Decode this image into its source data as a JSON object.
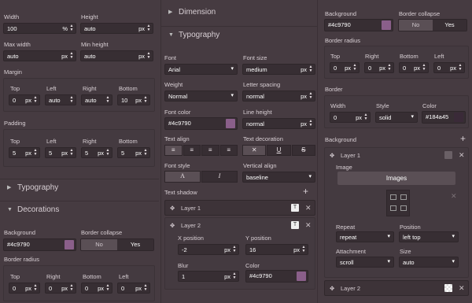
{
  "col1": {
    "width_label": "Width",
    "width_value": "100",
    "width_unit": "%",
    "height_label": "Height",
    "height_value": "auto",
    "height_unit": "px",
    "minwidth_label": "Max width",
    "minwidth_value": "auto",
    "minwidth_unit": "px",
    "minheight_label": "Min height",
    "minheight_value": "auto",
    "minheight_unit": "px",
    "margin_label": "Margin",
    "margin": {
      "top_label": "Top",
      "top_value": "0",
      "top_unit": "px",
      "left_label": "Left",
      "left_value": "auto",
      "right_label": "Right",
      "right_value": "auto",
      "bottom_label": "Bottom",
      "bottom_value": "10",
      "bottom_unit": "px"
    },
    "padding_label": "Padding",
    "padding": {
      "top_label": "Top",
      "top_value": "5",
      "top_unit": "px",
      "left_label": "Left",
      "left_value": "5",
      "left_unit": "px",
      "right_label": "Right",
      "right_value": "5",
      "right_unit": "px",
      "bottom_label": "Bottom",
      "bottom_value": "5",
      "bottom_unit": "px"
    },
    "typography_label": "Typography",
    "decorations_label": "Decorations",
    "background_label": "Background",
    "background_value": "#4c9790",
    "background_swatch": "#8a5f8a",
    "border_collapse_label": "Border collapse",
    "no_label": "No",
    "yes_label": "Yes",
    "border_radius_label": "Border radius",
    "radius": {
      "top_label": "Top",
      "top_value": "0",
      "right_label": "Right",
      "right_value": "0",
      "bottom_label": "Bottom",
      "bottom_value": "0",
      "left_label": "Left",
      "left_value": "0",
      "unit": "px"
    }
  },
  "col2": {
    "dimension_label": "Dimension",
    "typography_label": "Typography",
    "font_label": "Font",
    "font_value": "Arial",
    "fontsize_label": "Font size",
    "fontsize_value": "medium",
    "fontsize_unit": "px",
    "weight_label": "Weight",
    "weight_value": "Normal",
    "letterspacing_label": "Letter spacing",
    "letterspacing_value": "normal",
    "letterspacing_unit": "px",
    "fontcolor_label": "Font color",
    "fontcolor_value": "#4c9790",
    "fontcolor_swatch": "#8a5f8a",
    "lineheight_label": "Line height",
    "lineheight_value": "normal",
    "lineheight_unit": "px",
    "textalign_label": "Text align",
    "textdecoration_label": "Text decoration",
    "fontstyle_label": "Font style",
    "verticalalign_label": "Vertical align",
    "verticalalign_value": "baseline",
    "fontstyle_a": "A",
    "fontstyle_i": "I",
    "deco_none": "✕",
    "deco_u": "U",
    "deco_s": "S",
    "textshadow_label": "Text shadow",
    "layer1_label": "Layer 1",
    "layer2_label": "Layer 2",
    "xpos_label": "X position",
    "xpos_value": "-2",
    "xpos_unit": "px",
    "ypos_label": "Y position",
    "ypos_value": "16",
    "ypos_unit": "px",
    "blur_label": "Blur",
    "blur_value": "1",
    "blur_unit": "px",
    "color_label": "Color",
    "color_value": "#4c9790",
    "color_swatch": "#8a5f8a"
  },
  "col3": {
    "background_label": "Background",
    "background_value": "#4c9790",
    "background_swatch": "#8a5f8a",
    "border_collapse_label": "Border collapse",
    "no_label": "No",
    "yes_label": "Yes",
    "border_radius_label": "Border radius",
    "radius": {
      "top_label": "Top",
      "top_value": "0",
      "right_label": "Right",
      "right_value": "0",
      "bottom_label": "Bottom",
      "bottom_value": "0",
      "left_label": "Left",
      "left_value": "0",
      "unit": "px"
    },
    "border_label": "Border",
    "border": {
      "width_label": "Width",
      "width_value": "0",
      "width_unit": "px",
      "style_label": "Style",
      "style_value": "solid",
      "color_label": "Color",
      "color_value": "#184a45",
      "color_swatch": "#3a2a38"
    },
    "bg_label": "Background",
    "layer1_label": "Layer 1",
    "image_label": "Image",
    "images_button": "Images",
    "repeat_label": "Repeat",
    "repeat_value": "repeat",
    "position_label": "Position",
    "position_value": "left top",
    "attachment_label": "Attachment",
    "attachment_value": "scroll",
    "size_label": "Size",
    "size_value": "auto",
    "layer2_label": "Layer 2"
  }
}
